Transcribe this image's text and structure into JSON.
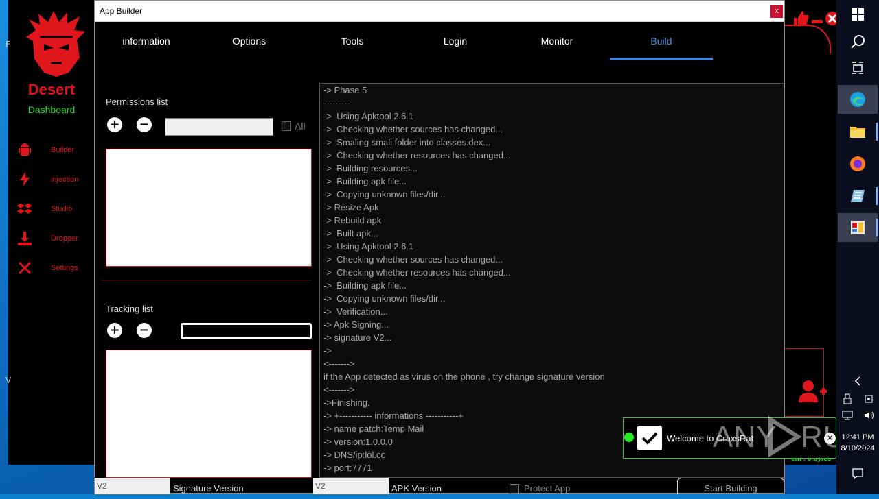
{
  "window": {
    "title": "App Builder",
    "close_label": "x"
  },
  "tabs": [
    {
      "label": "information"
    },
    {
      "label": "Options"
    },
    {
      "label": "Tools"
    },
    {
      "label": "Login"
    },
    {
      "label": "Monitor"
    },
    {
      "label": "Build",
      "active": true
    }
  ],
  "permissions": {
    "label": "Permissions list",
    "add_symbol": "+",
    "remove_symbol": "−",
    "all_label": "All"
  },
  "tracking": {
    "label": "Tracking list",
    "add_symbol": "+",
    "remove_symbol": "−"
  },
  "log_lines": [
    "-> Phase 5",
    "---------",
    "->  Using Apktool 2.6.1",
    "->  Checking whether sources has changed...",
    "->  Smaling smali folder into classes.dex...",
    "->  Checking whether resources has changed...",
    "->  Building resources...",
    "->  Building apk file...",
    "->  Copying unknown files/dir...",
    "-> Resize Apk",
    "-> Rebuild apk",
    "->  Built apk...",
    "->  Using Apktool 2.6.1",
    "->  Checking whether sources has changed...",
    "->  Checking whether resources has changed...",
    "->  Building apk file...",
    "->  Copying unknown files/dir...",
    "->  Verification...",
    "-> Apk Signing...",
    "-> signature V2...",
    "->",
    "<------->",
    "if the App detected as virus on the phone , try change signature version",
    "<------->",
    "->Finishing.",
    "-> +----------- informations -----------+",
    "-> name patch:Temp Mail",
    "-> version:1.0.0.0",
    "-> DNS/ip:lol.cc",
    "-> port:7771"
  ],
  "bottom": {
    "signature_value": "V2",
    "signature_label": "Signature Version",
    "apk_value": "V2",
    "apk_label": "APK Version",
    "protect_label": "Protect App",
    "start_label": "Start Building"
  },
  "background_app": {
    "brand_title": "Desert",
    "brand_sub": "Dashboard",
    "nav": [
      {
        "label": "Builder",
        "icon": "android-icon"
      },
      {
        "label": "injection",
        "icon": "bolt-icon"
      },
      {
        "label": "Studio",
        "icon": "dropbox-icon"
      },
      {
        "label": "Dropper",
        "icon": "download-icon"
      },
      {
        "label": "Settings",
        "icon": "tools-icon"
      }
    ],
    "status_text": "ent : 0 bytes",
    "edge_letter_1": "F",
    "edge_letter_2": "V"
  },
  "toast": {
    "message": "Welcome to CraxsRat"
  },
  "taskbar": {
    "time": "12:41 PM",
    "date": "8/10/2024"
  },
  "watermark": "ANY RUN",
  "colors": {
    "accent": "#3e86d9",
    "danger": "#e0161c",
    "success": "#22dd22"
  }
}
